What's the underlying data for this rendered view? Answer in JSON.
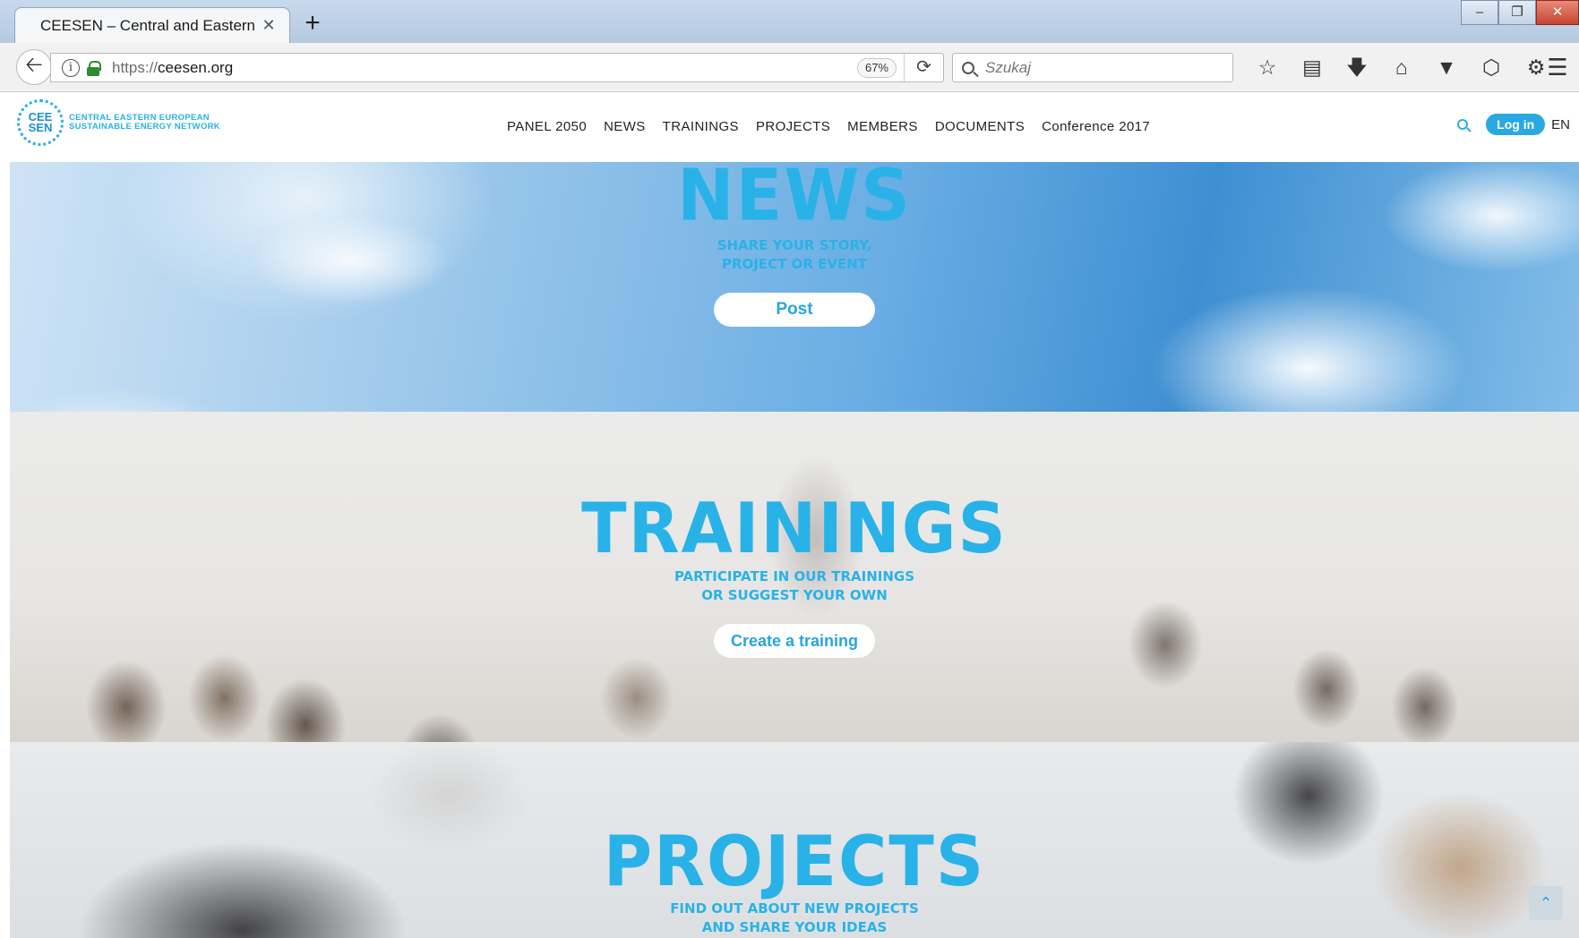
{
  "browser": {
    "tab_title": "CEESEN – Central and Eastern Eur",
    "tab_close": "✕",
    "new_tab": "+",
    "url_scheme": "https://",
    "url_host": "ceesen.org",
    "zoom": "67%",
    "search_placeholder": "Szukaj"
  },
  "site": {
    "logo_badge_top": "CEE",
    "logo_badge_bottom": "SEN",
    "logo_line1": "CENTRAL EASTERN EUROPEAN",
    "logo_line2": "SUSTAINABLE ENERGY NETWORK",
    "nav": [
      "PANEL 2050",
      "NEWS",
      "TRAININGS",
      "PROJECTS",
      "MEMBERS",
      "DOCUMENTS",
      "Conference 2017"
    ],
    "login": "Log in",
    "lang": "EN"
  },
  "sections": {
    "news": {
      "title": "NEWS",
      "sub1": "SHARE YOUR STORY,",
      "sub2": "PROJECT OR EVENT",
      "button": "Post"
    },
    "trainings": {
      "title": "TRAININGS",
      "sub1": "PARTICIPATE IN OUR TRAININGS",
      "sub2": "OR SUGGEST YOUR OWN",
      "button": "Create a training"
    },
    "projects": {
      "title": "PROJECTS",
      "sub1": "FIND OUT ABOUT NEW PROJECTS",
      "sub2": "AND SHARE YOUR IDEAS"
    }
  },
  "colors": {
    "accent": "#29b2e8",
    "login_bg": "#2aa9e0"
  },
  "icons": [
    "back-arrow-icon",
    "info-icon",
    "lock-icon",
    "reload-icon",
    "search-icon",
    "bookmark-star-icon",
    "reading-list-icon",
    "download-icon",
    "home-icon",
    "pocket-icon",
    "extension-icon",
    "puzzle-icon",
    "menu-icon",
    "scroll-top-icon"
  ]
}
